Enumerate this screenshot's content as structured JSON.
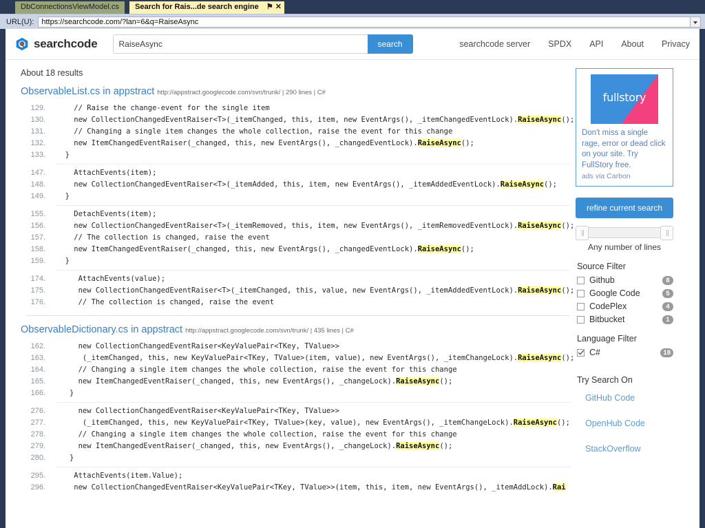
{
  "window": {
    "tabs": [
      {
        "title": "DbConnectionsViewModel.cs",
        "active": false
      },
      {
        "title": "Search for Rais...de search engine",
        "active": true
      }
    ],
    "pin_icon": "⚑",
    "close_icon": "✕",
    "url_label": "URL(U):",
    "url_value": "https://searchcode.com/?lan=6&q=RaiseAsync"
  },
  "header": {
    "brand": "searchcode",
    "brand_icon": "searchcode-logo-icon",
    "search_value": "RaiseAsync",
    "search_placeholder": "",
    "search_button": "search",
    "nav": [
      {
        "label": "searchcode server"
      },
      {
        "label": "SPDX"
      },
      {
        "label": "API"
      },
      {
        "label": "About"
      },
      {
        "label": "Privacy"
      }
    ]
  },
  "results": {
    "count_text": "About 18 results",
    "blocks": [
      {
        "title": "ObservableList.cs in appstract",
        "meta": "http://appstract.googlecode.com/svn/trunk/ | 290 lines | C#",
        "snippets": [
          {
            "lines": [
              {
                "no": "129.",
                "parts": [
                  {
                    "t": "    // Raise the change-event for the single item"
                  }
                ]
              },
              {
                "no": "130.",
                "parts": [
                  {
                    "t": "    new CollectionChangedEventRaiser<T>(_itemChanged, this, item, new EventArgs(), _itemChangedEventLock)."
                  },
                  {
                    "t": "RaiseAsync",
                    "hl": true
                  },
                  {
                    "t": "();"
                  }
                ]
              },
              {
                "no": "131.",
                "parts": [
                  {
                    "t": "    // Changing a single item changes the whole collection, raise the event for this change"
                  }
                ]
              },
              {
                "no": "132.",
                "parts": [
                  {
                    "t": "    new ItemChangedEventRaiser(_changed, this, new EventArgs(), _changedEventLock)."
                  },
                  {
                    "t": "RaiseAsync",
                    "hl": true
                  },
                  {
                    "t": "();"
                  }
                ]
              },
              {
                "no": "133.",
                "parts": [
                  {
                    "t": "  }"
                  }
                ]
              }
            ]
          },
          {
            "lines": [
              {
                "no": "147.",
                "parts": [
                  {
                    "t": "    AttachEvents(item);"
                  }
                ]
              },
              {
                "no": "148.",
                "parts": [
                  {
                    "t": "    new CollectionChangedEventRaiser<T>(_itemAdded, this, item, new EventArgs(), _itemAddedEventLock)."
                  },
                  {
                    "t": "RaiseAsync",
                    "hl": true
                  },
                  {
                    "t": "();"
                  }
                ]
              },
              {
                "no": "149.",
                "parts": [
                  {
                    "t": "  }"
                  }
                ]
              }
            ]
          },
          {
            "lines": [
              {
                "no": "155.",
                "parts": [
                  {
                    "t": "    DetachEvents(item);"
                  }
                ]
              },
              {
                "no": "156.",
                "parts": [
                  {
                    "t": "    new CollectionChangedEventRaiser<T>(_itemRemoved, this, item, new EventArgs(), _itemRemovedEventLock)."
                  },
                  {
                    "t": "RaiseAsync",
                    "hl": true
                  },
                  {
                    "t": "();"
                  }
                ]
              },
              {
                "no": "157.",
                "parts": [
                  {
                    "t": "    // The collection is changed, raise the event"
                  }
                ]
              },
              {
                "no": "158.",
                "parts": [
                  {
                    "t": "    new ItemChangedEventRaiser(_changed, this, new EventArgs(), _changedEventLock)."
                  },
                  {
                    "t": "RaiseAsync",
                    "hl": true
                  },
                  {
                    "t": "();"
                  }
                ]
              },
              {
                "no": "159.",
                "parts": [
                  {
                    "t": "  }"
                  }
                ]
              }
            ]
          },
          {
            "lines": [
              {
                "no": "174.",
                "parts": [
                  {
                    "t": "     AttachEvents(value);"
                  }
                ]
              },
              {
                "no": "175.",
                "parts": [
                  {
                    "t": "     new CollectionChangedEventRaiser<T>(_itemChanged, this, value, new EventArgs(), _itemAddedEventLock)."
                  },
                  {
                    "t": "RaiseAsync",
                    "hl": true
                  },
                  {
                    "t": "();"
                  }
                ]
              },
              {
                "no": "176.",
                "parts": [
                  {
                    "t": "     // The collection is changed, raise the event"
                  }
                ]
              }
            ]
          }
        ]
      },
      {
        "title": "ObservableDictionary.cs in appstract",
        "meta": "http://appstract.googlecode.com/svn/trunk/ | 435 lines | C#",
        "snippets": [
          {
            "lines": [
              {
                "no": "162.",
                "parts": [
                  {
                    "t": "     new CollectionChangedEventRaiser<KeyValuePair<TKey, TValue>>"
                  }
                ]
              },
              {
                "no": "163.",
                "parts": [
                  {
                    "t": "      (_itemChanged, this, new KeyValuePair<TKey, TValue>(item, value), new EventArgs(), _itemChangeLock)."
                  },
                  {
                    "t": "RaiseAsync",
                    "hl": true
                  },
                  {
                    "t": "();"
                  }
                ]
              },
              {
                "no": "164.",
                "parts": [
                  {
                    "t": "     // Changing a single item changes the whole collection, raise the event for this change"
                  }
                ]
              },
              {
                "no": "165.",
                "parts": [
                  {
                    "t": "     new ItemChangedEventRaiser(_changed, this, new EventArgs(), _changeLock)."
                  },
                  {
                    "t": "RaiseAsync",
                    "hl": true
                  },
                  {
                    "t": "();"
                  }
                ]
              },
              {
                "no": "166.",
                "parts": [
                  {
                    "t": "   }"
                  }
                ]
              }
            ]
          },
          {
            "lines": [
              {
                "no": "276.",
                "parts": [
                  {
                    "t": "     new CollectionChangedEventRaiser<KeyValuePair<TKey, TValue>>"
                  }
                ]
              },
              {
                "no": "277.",
                "parts": [
                  {
                    "t": "      (_itemChanged, this, new KeyValuePair<TKey, TValue>(key, value), new EventArgs(), _itemChangeLock)."
                  },
                  {
                    "t": "RaiseAsync",
                    "hl": true
                  },
                  {
                    "t": "();"
                  }
                ]
              },
              {
                "no": "278.",
                "parts": [
                  {
                    "t": "     // Changing a single item changes the whole collection, raise the event for this change"
                  }
                ]
              },
              {
                "no": "279.",
                "parts": [
                  {
                    "t": "     new ItemChangedEventRaiser(_changed, this, new EventArgs(), _changeLock)."
                  },
                  {
                    "t": "RaiseAsync",
                    "hl": true
                  },
                  {
                    "t": "();"
                  }
                ]
              },
              {
                "no": "280.",
                "parts": [
                  {
                    "t": "   }"
                  }
                ]
              }
            ]
          },
          {
            "lines": [
              {
                "no": "295.",
                "parts": [
                  {
                    "t": "    AttachEvents(item.Value);"
                  }
                ]
              },
              {
                "no": "296.",
                "parts": [
                  {
                    "t": "    new CollectionChangedEventRaiser<KeyValuePair<TKey, TValue>>(item, this, item, new EventArgs(), _itemAddLock)."
                  },
                  {
                    "t": "Rai",
                    "hl": true
                  }
                ]
              }
            ]
          }
        ]
      }
    ]
  },
  "sidebar": {
    "ad": {
      "image_text": "fullstory",
      "image_name": "fullstory-ad-image",
      "body": "Don't miss a single rage, error or dead click on your site. Try FullStory free.",
      "via": "ads via Carbon"
    },
    "refine_button": "refine current search",
    "slider_caption": "Any number of lines",
    "source_filter_title": "Source Filter",
    "source_filters": [
      {
        "label": "Github",
        "count": "8",
        "checked": false
      },
      {
        "label": "Google Code",
        "count": "5",
        "checked": false
      },
      {
        "label": "CodePlex",
        "count": "4",
        "checked": false
      },
      {
        "label": "Bitbucket",
        "count": "1",
        "checked": false
      }
    ],
    "language_filter_title": "Language Filter",
    "language_filters": [
      {
        "label": "C#",
        "count": "18",
        "checked": true
      }
    ],
    "try_title": "Try Search On",
    "try_links": [
      {
        "label": "GitHub Code"
      },
      {
        "label": "OpenHub Code"
      },
      {
        "label": "StackOverflow"
      }
    ]
  },
  "colors": {
    "accent": "#3a8fd4",
    "link": "#3a7fbf",
    "highlight": "#ffffa0",
    "tab_active": "#fdf2b8",
    "tab_inactive": "#9aa57a",
    "chrome": "#2b3a56"
  }
}
